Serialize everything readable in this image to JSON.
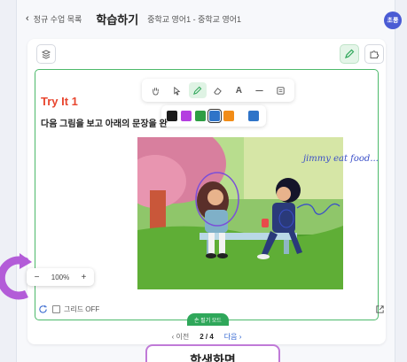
{
  "header": {
    "back_label": "정규 수업 목록",
    "title": "학습하기",
    "subtitle": "중학교 영어1 - 중학교 영어1",
    "profile_label": "초롱"
  },
  "lesson": {
    "heading": "Try It 1",
    "instruction": "다음 그림을 보고 아래의 문장을 완"
  },
  "draw_tools": [
    "hand",
    "select",
    "pen",
    "eraser",
    "text",
    "line",
    "shape"
  ],
  "palette": {
    "colors": [
      "#1b1b1b",
      "#b43fe0",
      "#2e9e44",
      "#2f74c8",
      "#f28c17"
    ],
    "extra_color": "#2f74c8",
    "selected_index": 3
  },
  "annotation_text": "jimmy eat food...",
  "zoom": {
    "minus": "−",
    "level": "100%",
    "plus": "+"
  },
  "grid_label": "그리드 OFF",
  "mode_label": "손 필기 모드",
  "pager": {
    "prev": "‹ 이전",
    "current": "2 / 4",
    "next": "다음 ›"
  },
  "submit_label": "학생화면",
  "accent": {
    "canvas_border": "#4cb96a",
    "heading": "#e8462f",
    "pen_ink": "#3a4fc8"
  }
}
